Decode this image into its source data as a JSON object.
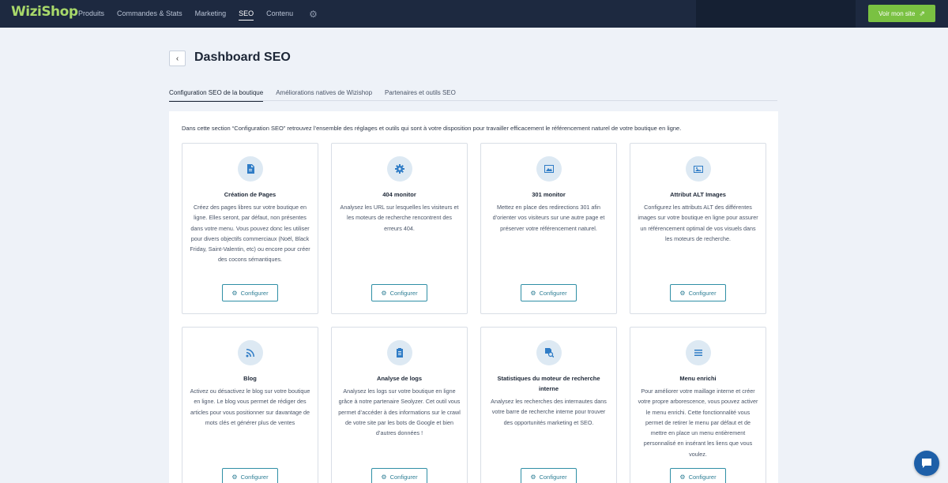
{
  "app": {
    "logo_left": "Wizi",
    "logo_right": "Shop"
  },
  "nav": {
    "items": [
      "Produits",
      "Commandes & Stats",
      "Marketing",
      "SEO",
      "Contenu"
    ],
    "active": "SEO",
    "settings_icon": "gear-icon"
  },
  "header": {
    "view_site": "Voir mon site",
    "view_site_icon": "external-link-icon"
  },
  "page": {
    "title": "Dashboard SEO",
    "back_icon": "chevron-left-icon"
  },
  "tabs": [
    "Configuration SEO de la boutique",
    "Améliorations natives de Wizishop",
    "Partenaires et outils SEO"
  ],
  "intro": "Dans cette section “Configuration SEO” retrouvez l’ensemble des réglages et outils qui sont à votre disposition pour travailler efficacement le référencement naturel de votre boutique en ligne.",
  "configure_label": "Configurer",
  "cards": [
    {
      "title": "Création de Pages",
      "icon": "document-icon",
      "desc": "Créez des pages libres sur votre boutique en ligne. Elles seront, par défaut, non présentes dans votre menu. Vous pouvez donc les utiliser pour divers objectifs commerciaux (Noël, Black Friday, Saint-Valentin, etc) ou encore pour créer des cocons sémantiques."
    },
    {
      "title": "404 monitor",
      "icon": "gear-icon",
      "desc": "Analysez les URL sur lesquelles les visiteurs et les moteurs de recherche rencontrent des erreurs 404."
    },
    {
      "title": "301 monitor",
      "icon": "redirect-image-icon",
      "desc": "Mettez en place des redirections 301 afin d’orienter vos visiteurs sur une autre page et préserver votre référencement naturel."
    },
    {
      "title": "Attribut ALT Images",
      "icon": "image-icon",
      "desc": "Configurez les attributs ALT des différentes images sur votre boutique en ligne pour assurer un référencement optimal de vos visuels dans les moteurs de recherche."
    },
    {
      "title": "Blog",
      "icon": "rss-icon",
      "desc": "Activez ou désactivez le blog sur votre boutique en ligne. Le blog vous permet de rédiger des articles pour vous positionner sur davantage de mots clés et générer plus de ventes"
    },
    {
      "title": "Analyse de logs",
      "icon": "clipboard-icon",
      "desc": "Analysez les logs sur votre boutique en ligne grâce à notre partenaire Seolyzer. Cet outil vous permet d’accéder à des informations sur le crawl de votre site par les bots de Google et bien d’autres données !"
    },
    {
      "title": "Statistiques du moteur de recherche interne",
      "icon": "search-document-icon",
      "desc": "Analysez les recherches des internautes dans votre barre de recherche interne pour trouver des opportunités marketing et SEO."
    },
    {
      "title": "Menu enrichi",
      "icon": "menu-icon",
      "desc": "Pour améliorer votre maillage interne et créer votre propre arborescence, vous pouvez activer le menu enrichi. Cette fonctionnalité vous permet de retirer le menu par défaut et de mettre en place un menu entièrement personnalisé en insérant les liens que vous voulez."
    }
  ],
  "chat_icon": "chat-icon"
}
